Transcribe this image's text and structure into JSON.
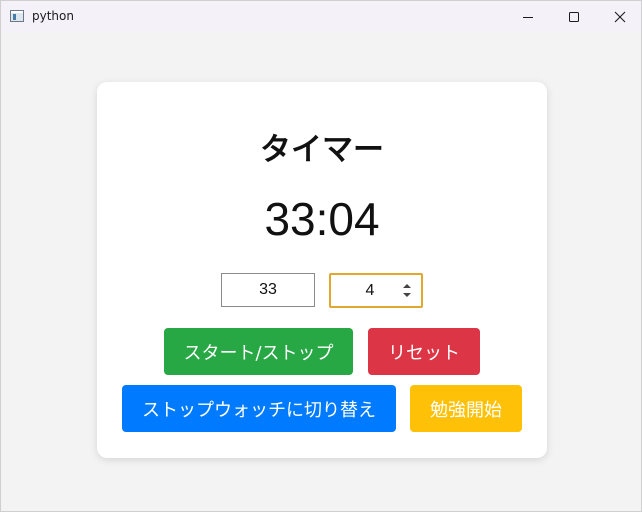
{
  "window": {
    "title": "python",
    "icon": "python-window-icon",
    "controls": [
      "minimize-icon",
      "maximize-icon",
      "close-icon"
    ]
  },
  "card": {
    "title": "タイマー",
    "time": "33:04",
    "minutes_input": {
      "value": "33"
    },
    "seconds_input": {
      "value": "4"
    },
    "buttons": {
      "start_stop": {
        "label": "スタート/ストップ",
        "color": "#28a745"
      },
      "reset": {
        "label": "リセット",
        "color": "#dc3545"
      },
      "switch": {
        "label": "ストップウォッチに切り替え",
        "color": "#007bff"
      },
      "study": {
        "label": "勉強開始",
        "color": "#ffc107"
      }
    }
  }
}
